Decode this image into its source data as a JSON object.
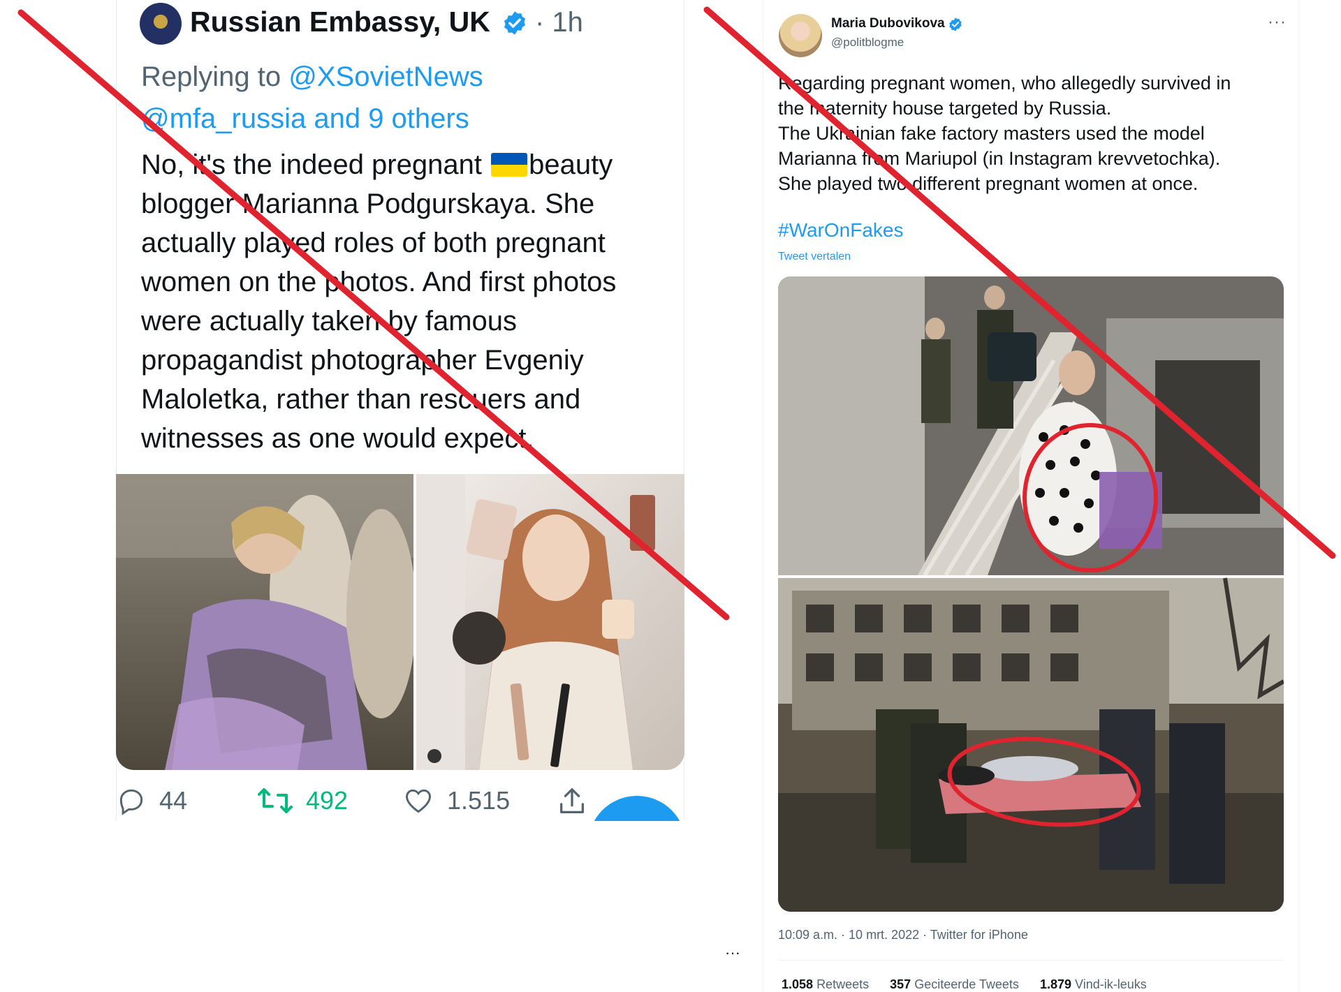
{
  "left_tweet": {
    "author_name": "Russian Embassy, UK",
    "time": "· 1h",
    "reply_label": "Replying to",
    "mentions_line1": "@XSovietNews",
    "mentions_line2": "@mfa_russia and 9 others",
    "text_before_flag": "No, it's the indeed pregnant",
    "text_after_flag": "beauty blogger Marianna Podgurskaya. She actually played roles of both pregnant women on the photos. And first photos were actually taken by famous propagandist photographer Evgeniy Maloletka, rather than rescuers and witnesses as one would expect.",
    "reply_count": "44",
    "retweet_count": "492",
    "like_count": "1.515",
    "icons": [
      "reply-icon",
      "retweet-icon",
      "like-icon",
      "share-icon",
      "verified-icon"
    ]
  },
  "right_tweet": {
    "author_name": "Maria Dubovikova",
    "handle": "@politblogme",
    "more": "···",
    "text_lines": [
      "Regarding pregnant women, who allegedly survived in",
      "the maternity house targeted by Russia.",
      "The Ukrainian fake factory masters used the model",
      "Marianna from Mariupol (in Instagram krevvetochka).",
      "She played two different pregnant women at once."
    ],
    "hashtag": "#WarOnFakes",
    "translate_label": "Tweet vertalen",
    "meta": "10:09 a.m. · 10 mrt. 2022 · Twitter for iPhone",
    "retweets_count": "1.058",
    "retweets_label": "Retweets",
    "quotes_count": "357",
    "quotes_label": "Geciteerde Tweets",
    "likes_count": "1.879",
    "likes_label": "Vind-ik-leuks"
  },
  "mid_ellipsis": "···",
  "colors": {
    "link": "#1d9bf0",
    "secondary_text": "#536471",
    "retweet_green": "#00ba7c",
    "strike_red": "#e0242f"
  }
}
